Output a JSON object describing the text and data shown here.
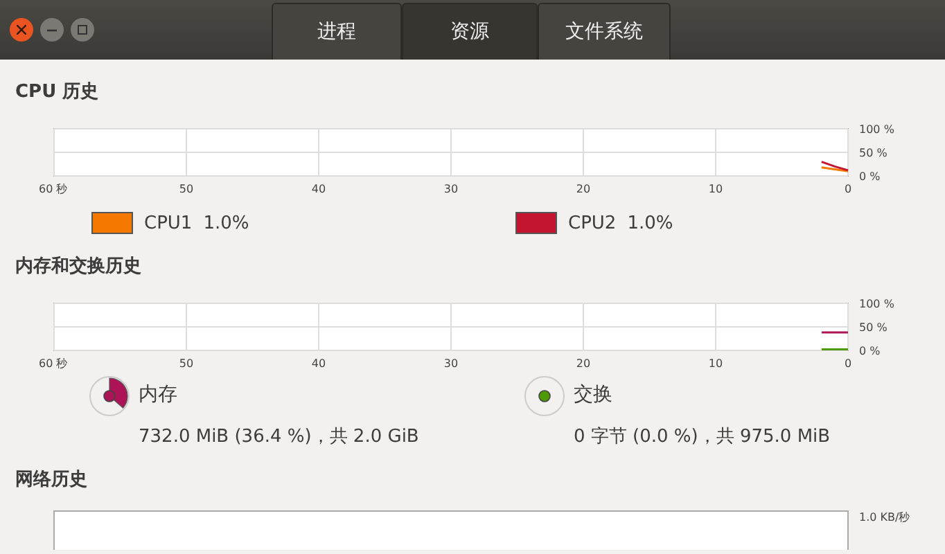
{
  "tabs": [
    {
      "label": "进程",
      "selected": false
    },
    {
      "label": "资源",
      "selected": true
    },
    {
      "label": "文件系统",
      "selected": false
    }
  ],
  "cpu": {
    "title": "CPU 历史",
    "chart_data": {
      "type": "line",
      "grid": true,
      "x": [
        2,
        1,
        0
      ],
      "xlim": [
        60,
        0
      ],
      "ylim": [
        0,
        100
      ],
      "xticks": [
        {
          "value": 60,
          "label": "60 秒"
        },
        50,
        40,
        30,
        20,
        10,
        0
      ],
      "yticks": [
        {
          "value": 0,
          "label": "0 %"
        },
        {
          "value": 50,
          "label": "50 %"
        },
        {
          "value": 100,
          "label": "100 %"
        }
      ],
      "series": [
        {
          "name": "CPU1",
          "color": "#f57900",
          "values": [
            18,
            14,
            10
          ]
        },
        {
          "name": "CPU2",
          "color": "#c4142f",
          "values": [
            30,
            20,
            12
          ]
        }
      ]
    },
    "legend": [
      {
        "value": "1.0%"
      },
      {
        "value": "1.0%"
      }
    ]
  },
  "memory": {
    "title": "内存和交换历史",
    "graph": {
      "y_labels": [
        "100 %",
        "50 %",
        "0 %"
      ],
      "x_labels": [
        "60 秒",
        "50",
        "40",
        "30",
        "20",
        "10",
        "0"
      ]
    },
    "legend": [
      {
        "kind": "pie",
        "label": "内存",
        "color": "#ad1457",
        "detail": "732.0 MiB (36.4 %)，共 2.0 GiB"
      },
      {
        "kind": "dot",
        "label": "交换",
        "color": "#4e9a06",
        "detail": "0 字节 (0.0 %)，共 975.0 MiB"
      }
    ]
  },
  "network": {
    "title": "网络历史",
    "top_tick": "1.0 KB/秒"
  }
}
